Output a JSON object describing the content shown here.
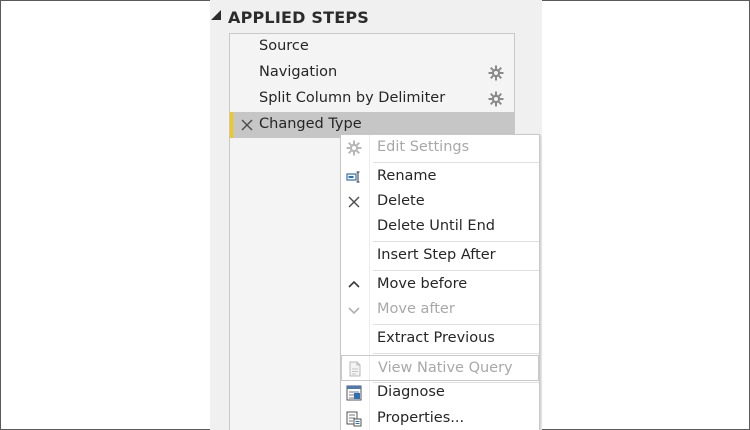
{
  "panel": {
    "title": "APPLIED STEPS",
    "collapse_icon": "triangle-down-icon"
  },
  "steps": [
    {
      "label": "Source",
      "has_settings": false
    },
    {
      "label": "Navigation",
      "has_settings": true
    },
    {
      "label": "Split Column by Delimiter",
      "has_settings": true
    },
    {
      "label": "Changed Type",
      "has_settings": false,
      "selected": true
    }
  ],
  "colors": {
    "accent": "#f2c811",
    "selected_bg": "#c6c6c6",
    "disabled_text": "#a8a8a8"
  },
  "context_menu": {
    "items": [
      {
        "label": "Edit Settings",
        "icon": "gear-icon",
        "enabled": false
      },
      {
        "label": "Rename",
        "icon": "rename-icon",
        "enabled": true
      },
      {
        "label": "Delete",
        "icon": "x-icon",
        "enabled": true
      },
      {
        "label": "Delete Until End",
        "icon": "",
        "enabled": true
      },
      {
        "label": "Insert Step After",
        "icon": "",
        "enabled": true
      },
      {
        "label": "Move before",
        "icon": "chevron-up-icon",
        "enabled": true
      },
      {
        "label": "Move after",
        "icon": "chevron-down-icon",
        "enabled": false
      },
      {
        "label": "Extract Previous",
        "icon": "",
        "enabled": true
      },
      {
        "label": "View Native Query",
        "icon": "document-icon",
        "enabled": false
      },
      {
        "label": "Diagnose",
        "icon": "diagnose-icon",
        "enabled": true
      },
      {
        "label": "Properties...",
        "icon": "properties-icon",
        "enabled": true
      }
    ]
  }
}
